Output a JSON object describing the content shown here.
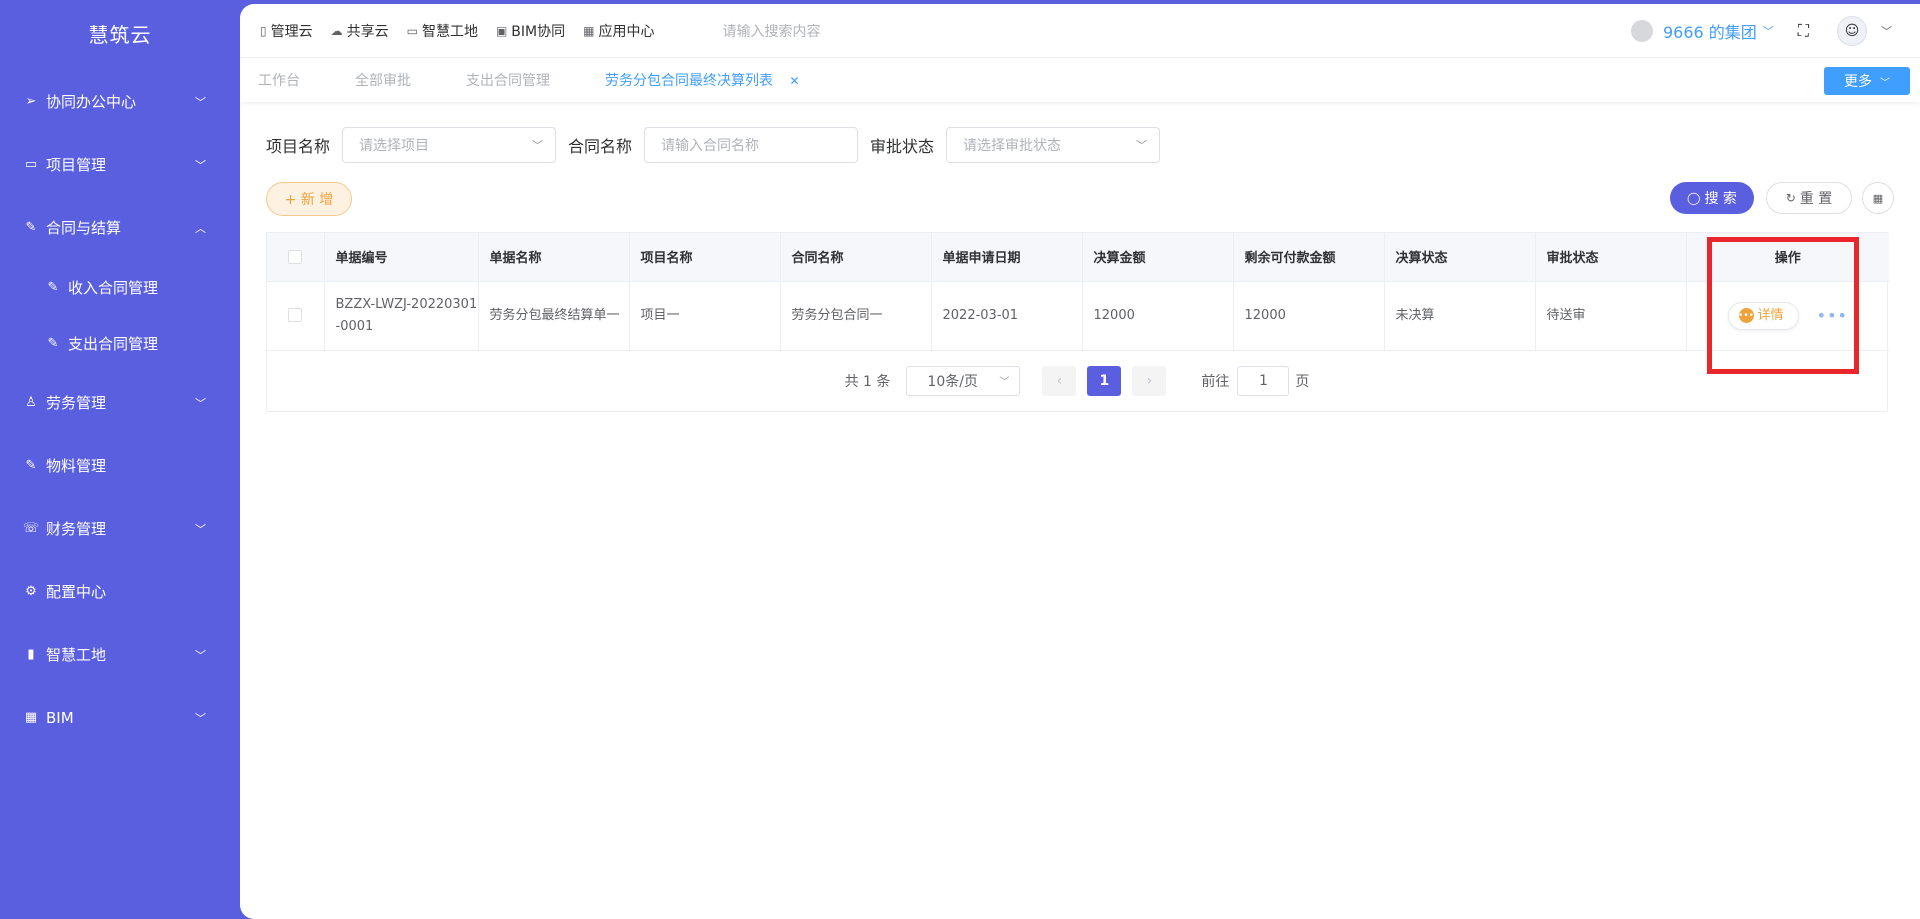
{
  "sidebar": {
    "logo": "慧筑云",
    "items": [
      {
        "label": "协同办公中心",
        "icon": "send-icon",
        "chevron": "⌄"
      },
      {
        "label": "项目管理",
        "icon": "book-icon",
        "chevron": "⌄"
      },
      {
        "label": "合同与结算",
        "icon": "edit-icon",
        "chevron": "⌃"
      },
      {
        "label": "劳务管理",
        "icon": "worker-icon",
        "chevron": "⌄"
      },
      {
        "label": "物料管理",
        "icon": "edit-icon",
        "chevron": ""
      },
      {
        "label": "财务管理",
        "icon": "phone-icon",
        "chevron": "⌄"
      },
      {
        "label": "配置中心",
        "icon": "gear-icon",
        "chevron": ""
      },
      {
        "label": "智慧工地",
        "icon": "bar-chart-icon",
        "chevron": "⌄"
      },
      {
        "label": "BIM",
        "icon": "grid-icon",
        "chevron": "⌄"
      }
    ],
    "sub_items": [
      {
        "label": "收入合同管理"
      },
      {
        "label": "支出合同管理"
      }
    ]
  },
  "topbar": {
    "nav": [
      {
        "label": "管理云"
      },
      {
        "label": "共享云"
      },
      {
        "label": "智慧工地"
      },
      {
        "label": "BIM协同"
      },
      {
        "label": "应用中心"
      }
    ],
    "search_placeholder": "请输入搜索内容",
    "group": "9666 的集团"
  },
  "tabs": {
    "items": [
      {
        "label": "工作台"
      },
      {
        "label": "全部审批"
      },
      {
        "label": "支出合同管理"
      },
      {
        "label": "劳务分包合同最终决算列表"
      }
    ],
    "more": "更多"
  },
  "filters": {
    "project_label": "项目名称",
    "project_placeholder": "请选择项目",
    "contract_label": "合同名称",
    "contract_placeholder": "请输入合同名称",
    "approval_label": "审批状态",
    "approval_placeholder": "请选择审批状态"
  },
  "actions": {
    "add": "+ 新 增",
    "search": "搜 索",
    "reset": "重 置"
  },
  "table": {
    "headers": [
      "单据编号",
      "单据名称",
      "项目名称",
      "合同名称",
      "单据申请日期",
      "决算金额",
      "剩余可付款金额",
      "决算状态",
      "审批状态",
      "操作"
    ],
    "rows": [
      {
        "doc_no": "BZZX-LWZJ-20220301-0001",
        "doc_name": "劳务分包最终结算单一",
        "project": "项目一",
        "contract": "劳务分包合同一",
        "date": "2022-03-01",
        "amount": "12000",
        "remaining": "12000",
        "settle_status": "未决算",
        "approval_status": "待送审",
        "detail": "详情"
      }
    ]
  },
  "pagination": {
    "total": "共 1 条",
    "page_size": "10条/页",
    "current": "1",
    "goto_label": "前往",
    "goto_value": "1",
    "page_unit": "页"
  }
}
